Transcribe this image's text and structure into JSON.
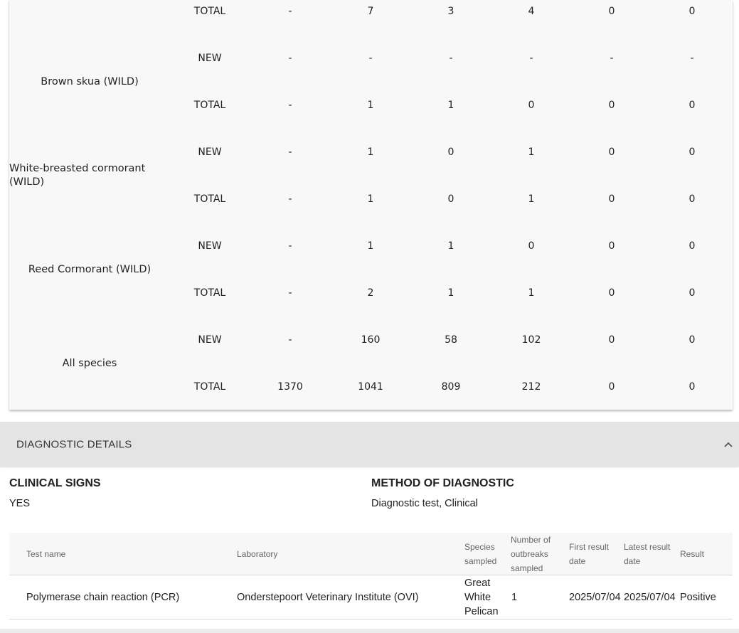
{
  "species_table": {
    "rows": [
      {
        "species": "",
        "type": "TOTAL",
        "values": [
          "-",
          "7",
          "3",
          "4",
          "0",
          "0"
        ]
      },
      {
        "species": "Brown skua (WILD)",
        "type": "NEW",
        "values": [
          "-",
          "-",
          "-",
          "-",
          "-",
          "-"
        ]
      },
      {
        "species": "",
        "type": "TOTAL",
        "values": [
          "-",
          "1",
          "1",
          "0",
          "0",
          "0"
        ]
      },
      {
        "species": "White-breasted cormorant (WILD)",
        "type": "NEW",
        "values": [
          "-",
          "1",
          "0",
          "1",
          "0",
          "0"
        ]
      },
      {
        "species": "",
        "type": "TOTAL",
        "values": [
          "-",
          "1",
          "0",
          "1",
          "0",
          "0"
        ]
      },
      {
        "species": "Reed Cormorant (WILD)",
        "type": "NEW",
        "values": [
          "-",
          "1",
          "1",
          "0",
          "0",
          "0"
        ]
      },
      {
        "species": "",
        "type": "TOTAL",
        "values": [
          "-",
          "2",
          "1",
          "1",
          "0",
          "0"
        ]
      },
      {
        "species": "All species",
        "type": "NEW",
        "values": [
          "-",
          "160",
          "58",
          "102",
          "0",
          "0"
        ]
      },
      {
        "species": "",
        "type": "TOTAL",
        "values": [
          "1370",
          "1041",
          "809",
          "212",
          "0",
          "0"
        ]
      }
    ]
  },
  "diagnostic": {
    "title": "DIAGNOSTIC DETAILS",
    "toggle_icon": "chevron-up-icon",
    "clinical_signs_label": "CLINICAL SIGNS",
    "clinical_signs_value": "YES",
    "method_label": "METHOD OF DIAGNOSTIC",
    "method_value": "Diagnostic test, Clinical"
  },
  "tests": {
    "headers": {
      "test_name": "Test name",
      "laboratory": "Laboratory",
      "species_sampled": "Species sampled",
      "outbreaks_sampled": "Number of outbreaks sampled",
      "first_result": "First result date",
      "latest_result": "Latest result date",
      "result": "Result"
    },
    "rows": [
      {
        "test_name": "Polymerase chain reaction (PCR)",
        "laboratory": "Onderstepoort Veterinary Institute (OVI)",
        "species_sampled": "Great White Pelican",
        "outbreaks_sampled": "1",
        "first_result": "2025/07/04",
        "latest_result": "2025/07/04",
        "result": "Positive"
      }
    ]
  }
}
